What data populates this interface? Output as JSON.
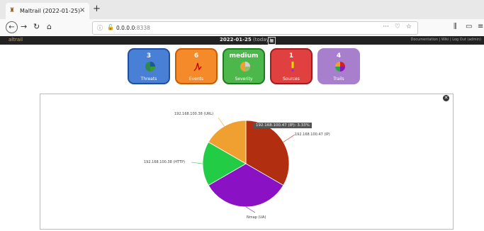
{
  "browser": {
    "tab_title": "Maltrail (2022-01-25)",
    "tab_close": "×",
    "new_tab": "+",
    "url_host": "0.0.0.0",
    "url_port": ":8338",
    "url_more": "···"
  },
  "app": {
    "logo_text": "altrail",
    "date": "2022-01-25",
    "date_suffix": " (today)",
    "header_links": "Documentation | Wiki | Log Out (admin)"
  },
  "cards": [
    {
      "value": "3",
      "label": "Threats",
      "color": "#4a7fd6",
      "border": "#1e4fa0",
      "icon": "pie-chart-icon"
    },
    {
      "value": "6",
      "label": "Events",
      "color": "#f58a2a",
      "border": "#c85a00",
      "icon": "sparkline-icon"
    },
    {
      "value": "medium",
      "label": "Severity",
      "color": "#4cb84c",
      "border": "#1f7a1f",
      "icon": "pie-chart-icon"
    },
    {
      "value": "1",
      "label": "Sources",
      "color": "#e04040",
      "border": "#9e1d1d",
      "icon": "exclamation-icon"
    },
    {
      "value": "4",
      "label": "Trails",
      "color": "#a87fcc",
      "border": "#a87fcc",
      "icon": "pie-chart-icon"
    }
  ],
  "chart_data": {
    "type": "pie",
    "slices": [
      {
        "label": "192.168.100.47 (IP)",
        "value": 0.3333,
        "color": "#b22e10"
      },
      {
        "label": "Nmap (UA)",
        "value": 0.3333,
        "color": "#8b12c4"
      },
      {
        "label": "192.168.100.38 (HTTP)",
        "value": 0.1667,
        "color": "#22cc44"
      },
      {
        "label": "192.168.100.38 (URL)",
        "value": 0.1667,
        "color": "#f0a030"
      }
    ],
    "tooltip": "192.168.100.47 (IP): 3.33%"
  }
}
